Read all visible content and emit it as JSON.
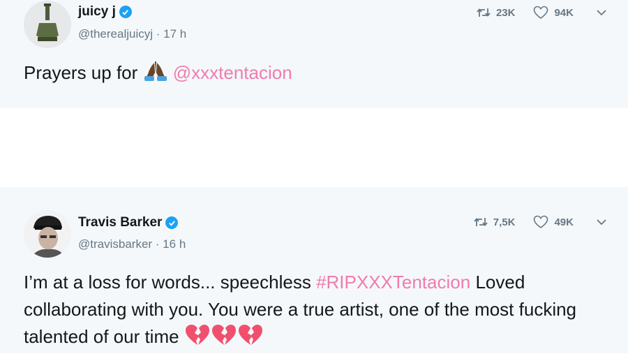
{
  "tweets": [
    {
      "name": "juicy j",
      "handle": "@therealjuicyj",
      "time": "· 17 h",
      "retweets": "23K",
      "likes": "94K",
      "text_before": "Prayers up for",
      "mention": "@xxxtentacion"
    },
    {
      "name": "Travis Barker",
      "handle": "@travisbarker",
      "time": "· 16 h",
      "retweets": "7,5K",
      "likes": "49K",
      "text_before": "I’m at a loss for words... speechless",
      "hashtag": "#RIPXXXTentacion",
      "text_after": "Loved collaborating with you. You were a true artist, one of the most fucking talented of our time"
    }
  ],
  "icons": {
    "verified": "verified-badge-icon",
    "retweet": "retweet-icon",
    "like": "heart-icon",
    "more": "chevron-down-icon",
    "pray": "folded-hands-emoji",
    "broken_heart": "broken-heart-emoji"
  },
  "colors": {
    "link": "#f07bb0",
    "verified": "#1da1f2",
    "meta": "#657786",
    "card_bg": "#f5f8fa"
  }
}
